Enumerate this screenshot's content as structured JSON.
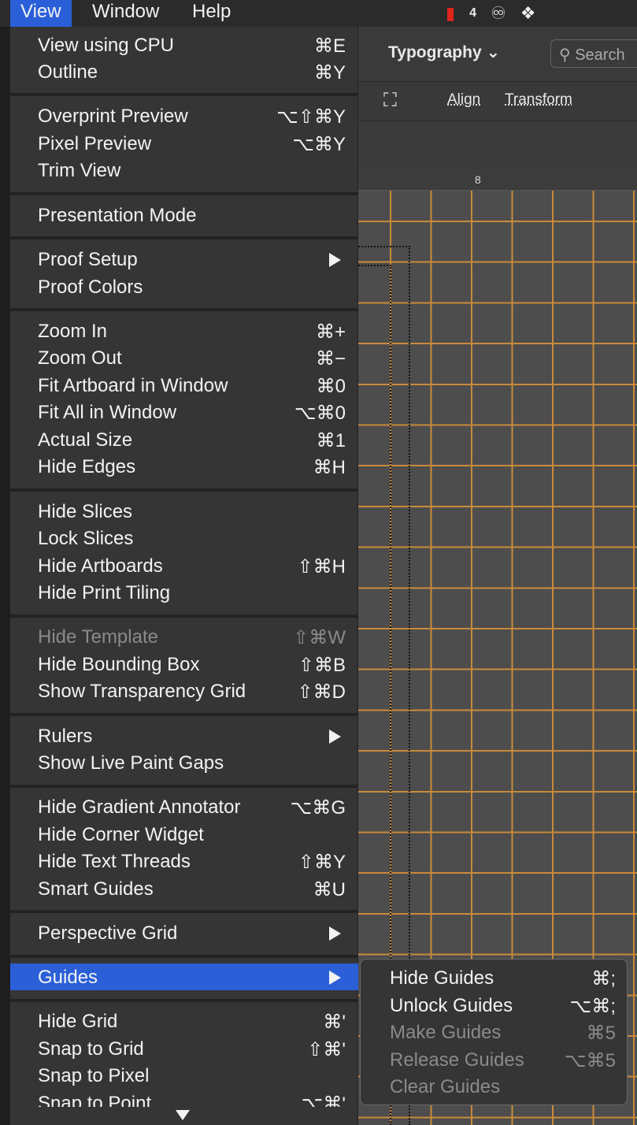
{
  "menubar": {
    "items": [
      "View",
      "Window",
      "Help"
    ],
    "tray_badge": "4"
  },
  "app": {
    "workspace": "Typography",
    "search_placeholder": "Search",
    "toolbar": [
      "Align",
      "Transform"
    ],
    "ruler_mark": "8"
  },
  "view_menu": {
    "items": [
      {
        "label": "View using CPU",
        "shortcut": "⌘E"
      },
      {
        "label": "Outline",
        "shortcut": "⌘Y"
      },
      {
        "label": "Overprint Preview",
        "shortcut": "⌥⇧⌘Y"
      },
      {
        "label": "Pixel Preview",
        "shortcut": "⌥⌘Y"
      },
      {
        "label": "Trim View",
        "shortcut": ""
      },
      {
        "label": "Presentation Mode",
        "shortcut": ""
      },
      {
        "label": "Proof Setup",
        "shortcut": "",
        "submenu": true
      },
      {
        "label": "Proof Colors",
        "shortcut": ""
      },
      {
        "label": "Zoom In",
        "shortcut": "⌘+"
      },
      {
        "label": "Zoom Out",
        "shortcut": "⌘−"
      },
      {
        "label": "Fit Artboard in Window",
        "shortcut": "⌘0"
      },
      {
        "label": "Fit All in Window",
        "shortcut": "⌥⌘0"
      },
      {
        "label": "Actual Size",
        "shortcut": "⌘1"
      },
      {
        "label": "Hide Edges",
        "shortcut": "⌘H"
      },
      {
        "label": "Hide Slices",
        "shortcut": ""
      },
      {
        "label": "Lock Slices",
        "shortcut": ""
      },
      {
        "label": "Hide Artboards",
        "shortcut": "⇧⌘H"
      },
      {
        "label": "Hide Print Tiling",
        "shortcut": ""
      },
      {
        "label": "Hide Template",
        "shortcut": "⇧⌘W",
        "disabled": true
      },
      {
        "label": "Hide Bounding Box",
        "shortcut": "⇧⌘B"
      },
      {
        "label": "Show Transparency Grid",
        "shortcut": "⇧⌘D"
      },
      {
        "label": "Rulers",
        "shortcut": "",
        "submenu": true
      },
      {
        "label": "Show Live Paint Gaps",
        "shortcut": ""
      },
      {
        "label": "Hide Gradient Annotator",
        "shortcut": "⌥⌘G"
      },
      {
        "label": "Hide Corner Widget",
        "shortcut": ""
      },
      {
        "label": "Hide Text Threads",
        "shortcut": "⇧⌘Y"
      },
      {
        "label": "Smart Guides",
        "shortcut": "⌘U"
      },
      {
        "label": "Perspective Grid",
        "shortcut": "",
        "submenu": true
      },
      {
        "label": "Guides",
        "shortcut": "",
        "submenu": true,
        "highlighted": true
      },
      {
        "label": "Hide Grid",
        "shortcut": "⌘'"
      },
      {
        "label": "Snap to Grid",
        "shortcut": "⇧⌘'"
      },
      {
        "label": "Snap to Pixel",
        "shortcut": ""
      },
      {
        "label": "Snap to Point",
        "shortcut": "⌥⌘'"
      }
    ]
  },
  "guides_submenu": {
    "items": [
      {
        "label": "Hide Guides",
        "shortcut": "⌘;"
      },
      {
        "label": "Unlock Guides",
        "shortcut": "⌥⌘;"
      },
      {
        "label": "Make Guides",
        "shortcut": "⌘5",
        "disabled": true
      },
      {
        "label": "Release Guides",
        "shortcut": "⌥⌘5",
        "disabled": true
      },
      {
        "label": "Clear Guides",
        "shortcut": "",
        "disabled": true
      }
    ]
  }
}
